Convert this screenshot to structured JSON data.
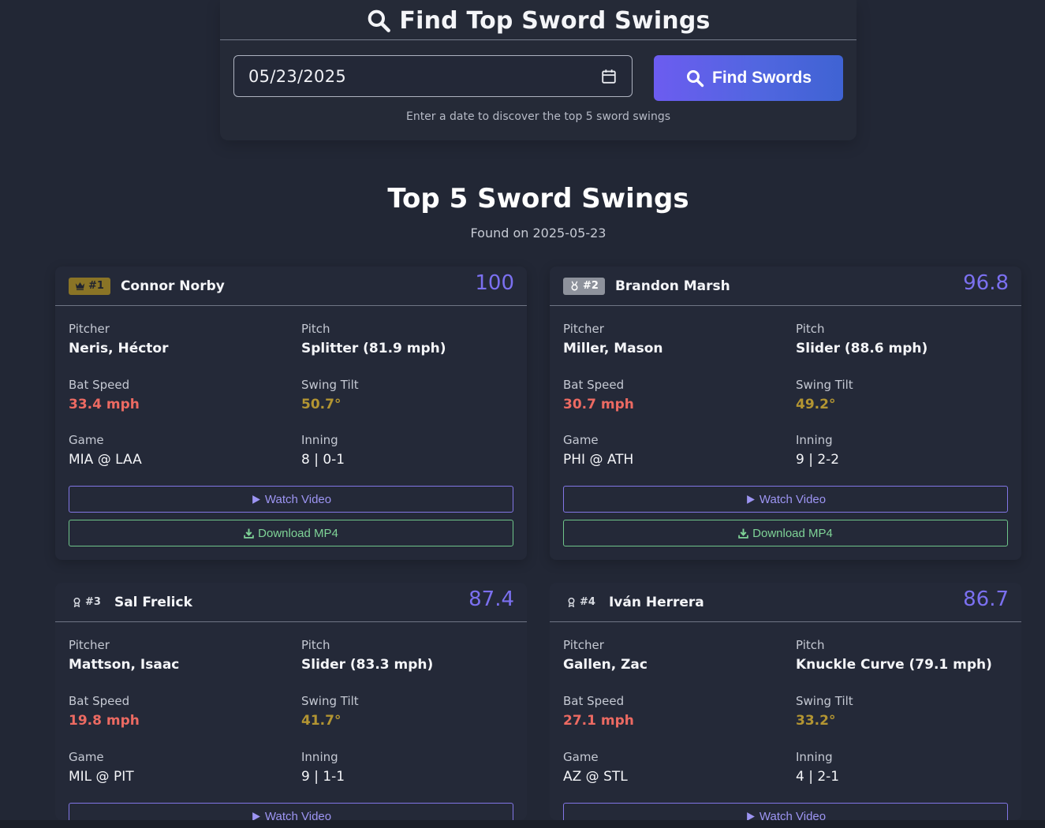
{
  "search": {
    "title": "Find Top Sword Swings",
    "date_value": "05/23/2025",
    "button_label": "Find Swords",
    "hint": "Enter a date to discover the top 5 sword swings"
  },
  "results": {
    "title": "Top 5 Sword Swings",
    "subtitle": "Found on 2025-05-23"
  },
  "labels": {
    "pitcher": "Pitcher",
    "pitch": "Pitch",
    "bat_speed": "Bat Speed",
    "swing_tilt": "Swing Tilt",
    "game": "Game",
    "inning": "Inning",
    "watch": "Watch Video",
    "download": "Download MP4"
  },
  "cards": [
    {
      "rank": "#1",
      "rank_icon": "crown-icon",
      "player": "Connor Norby",
      "score": "100",
      "pitcher": "Neris, Héctor",
      "pitch": "Splitter (81.9 mph)",
      "bat_speed": "33.4 mph",
      "swing_tilt": "50.7°",
      "game": "MIA @ LAA",
      "inning": "8 | 0-1"
    },
    {
      "rank": "#2",
      "rank_icon": "medal-icon",
      "player": "Brandon Marsh",
      "score": "96.8",
      "pitcher": "Miller, Mason",
      "pitch": "Slider (88.6 mph)",
      "bat_speed": "30.7 mph",
      "swing_tilt": "49.2°",
      "game": "PHI @ ATH",
      "inning": "9 | 2-2"
    },
    {
      "rank": "#3",
      "rank_icon": "award-icon",
      "player": "Sal Frelick",
      "score": "87.4",
      "pitcher": "Mattson, Isaac",
      "pitch": "Slider (83.3 mph)",
      "bat_speed": "19.8 mph",
      "swing_tilt": "41.7°",
      "game": "MIL @ PIT",
      "inning": "9 | 1-1"
    },
    {
      "rank": "#4",
      "rank_icon": "award-icon",
      "player": "Iván Herrera",
      "score": "86.7",
      "pitcher": "Gallen, Zac",
      "pitch": "Knuckle Curve (79.1 mph)",
      "bat_speed": "27.1 mph",
      "swing_tilt": "33.2°",
      "game": "AZ @ STL",
      "inning": "4 | 2-1"
    }
  ],
  "colors": {
    "background": "#222735",
    "accent": "#6c5cf0",
    "score": "#7b70f0",
    "bat_speed": "#ec6a62",
    "swing_tilt": "#b39532",
    "download": "#7fd497"
  }
}
